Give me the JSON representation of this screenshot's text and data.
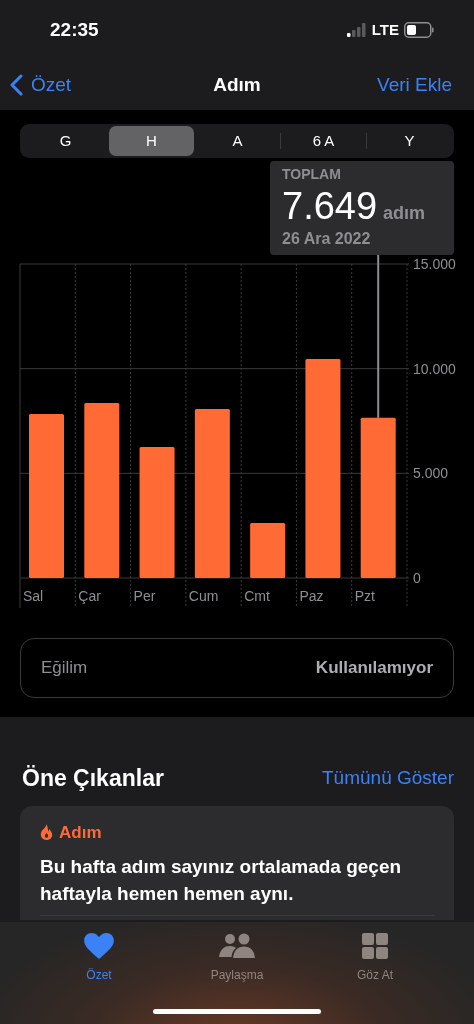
{
  "status_bar": {
    "time": "22:35",
    "network": "LTE"
  },
  "nav": {
    "back": "Özet",
    "title": "Adım",
    "action": "Veri Ekle"
  },
  "segments": [
    {
      "label": "G",
      "selected": false
    },
    {
      "label": "H",
      "selected": true
    },
    {
      "label": "A",
      "selected": false
    },
    {
      "label": "6 A",
      "selected": false
    },
    {
      "label": "Y",
      "selected": false
    }
  ],
  "tooltip": {
    "label": "TOPLAM",
    "value": "7.649",
    "unit": "adım",
    "date": "26 Ara 2022"
  },
  "chart_data": {
    "type": "bar",
    "categories": [
      "Sal",
      "Çar",
      "Per",
      "Cum",
      "Cmt",
      "Paz",
      "Pzt"
    ],
    "series": [
      {
        "color": "#ff6a35",
        "values": [
          7830,
          8360,
          6260,
          8070,
          2630,
          10460,
          7650
        ]
      }
    ],
    "ylim": [
      0,
      15000
    ],
    "yticks": [
      {
        "value": 0,
        "label": "0"
      },
      {
        "value": 5000,
        "label": "5.000"
      },
      {
        "value": 10000,
        "label": "10.000"
      },
      {
        "value": 15000,
        "label": "15.000"
      }
    ]
  },
  "trend": {
    "label": "Eğilim",
    "value": "Kullanılamıyor"
  },
  "highlights": {
    "title": "Öne Çıkanlar",
    "link": "Tümünü Göster",
    "card": {
      "category": "Adım",
      "text": "Bu hafta adım sayınız ortalamada geçen haftayla hemen hemen aynı."
    }
  },
  "tab_bar": [
    {
      "label": "Özet",
      "kind": "heart",
      "selected": true
    },
    {
      "label": "Paylaşma",
      "kind": "people",
      "selected": false
    },
    {
      "label": "Göz At",
      "kind": "grid",
      "selected": false
    }
  ]
}
